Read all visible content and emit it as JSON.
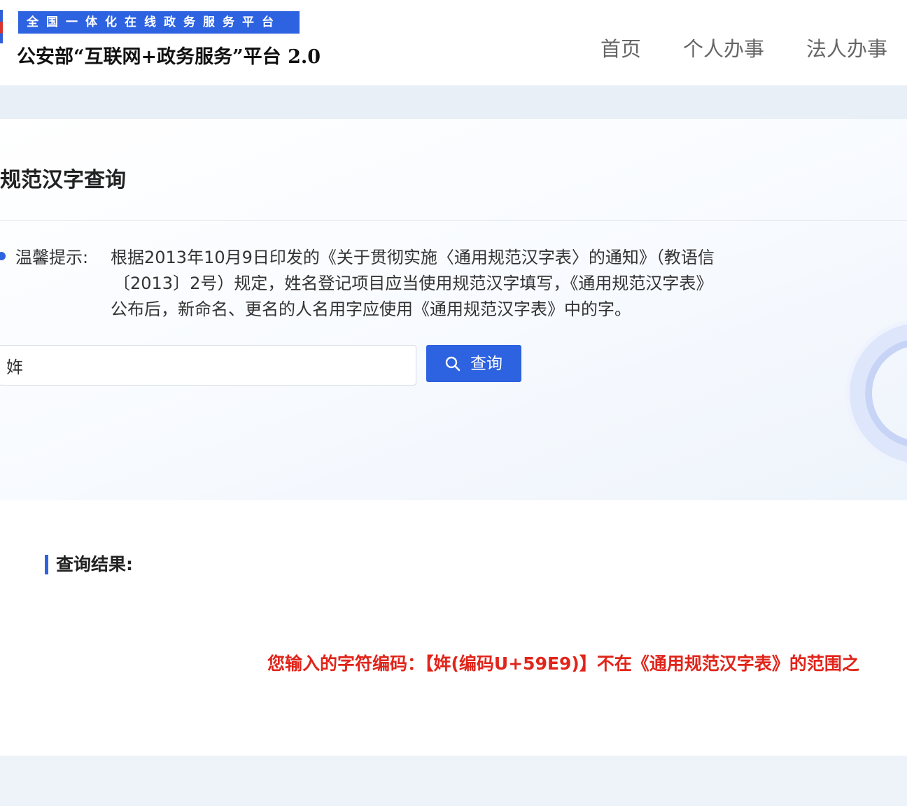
{
  "header": {
    "platform_banner": "全国一体化在线政务服务平台",
    "site_title": "公安部“互联网+政务服务”平台 2.0",
    "nav": [
      "首页",
      "个人办事",
      "法人办事"
    ]
  },
  "search": {
    "page_title": "规范汉字查询",
    "tip_label": "温馨提示:",
    "tip_lines": [
      "根据2013年10月9日印发的《关于贯彻实施〈通用规范汉字表〉的通知》（教语信",
      "〔2013〕2号）规定，姓名登记项目应当使用规范汉字填写，《通用规范汉字表》",
      "公布后，新命名、更名的人名用字应使用《通用规范汉字表》中的字。"
    ],
    "input_value": "姩",
    "button_label": "查询",
    "button_icon": "search-icon"
  },
  "results": {
    "title": "查询结果:",
    "message": "您输入的字符编码：【姩(编码U+59E9)】不在《通用规范汉字表》的范围之"
  },
  "colors": {
    "accent": "#2d62e0",
    "error": "#e0251b"
  }
}
